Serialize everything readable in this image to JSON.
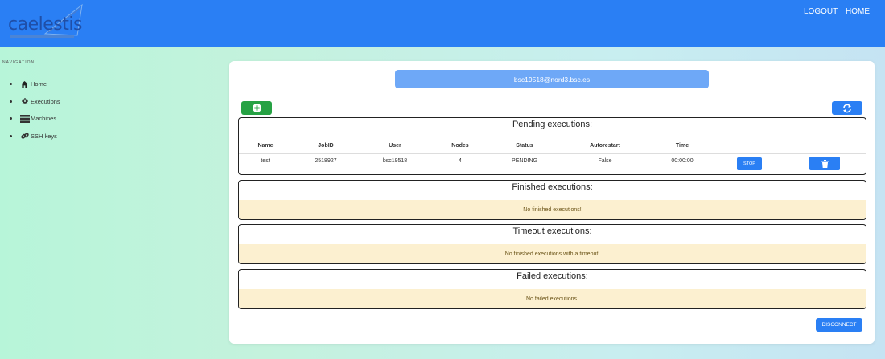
{
  "header": {
    "logo_text": "caelestis",
    "logout_label": "LOGOUT",
    "home_label": "HOME",
    "bar_color": "#2a7ff4"
  },
  "sidebar": {
    "title": "NAVIGATION",
    "items": [
      {
        "label": "Home",
        "icon": "home-icon"
      },
      {
        "label": "Executions",
        "icon": "gear-icon"
      },
      {
        "label": "Machines",
        "icon": "server-icon"
      },
      {
        "label": "SSH keys",
        "icon": "link-icon"
      }
    ]
  },
  "main": {
    "connection": "bsc19518@nord3.bsc.es",
    "add_icon": "plus-circle-icon",
    "refresh_icon": "refresh-icon",
    "pending": {
      "title": "Pending executions:",
      "columns": [
        "Name",
        "JobID",
        "User",
        "Nodes",
        "Status",
        "Autorestart",
        "Time"
      ],
      "rows": [
        {
          "name": "test",
          "jobid": "2518927",
          "user": "bsc19518",
          "nodes": "4",
          "status": "PENDING",
          "autorestart": "False",
          "time": "00:00:00"
        }
      ],
      "stop_label": "STOP",
      "delete_icon": "trash-icon"
    },
    "finished": {
      "title": "Finished executions:",
      "empty": "No finished executions!"
    },
    "timeout": {
      "title": "Timeout executions:",
      "empty": "No finished executions with a timeout!"
    },
    "failed": {
      "title": "Failed executions:",
      "empty": "No failed executions."
    },
    "disconnect_label": "DISCONNECT",
    "colors": {
      "primary": "#2a7ff4",
      "success": "#26a244",
      "warning_bg": "#fcf0d0"
    }
  }
}
